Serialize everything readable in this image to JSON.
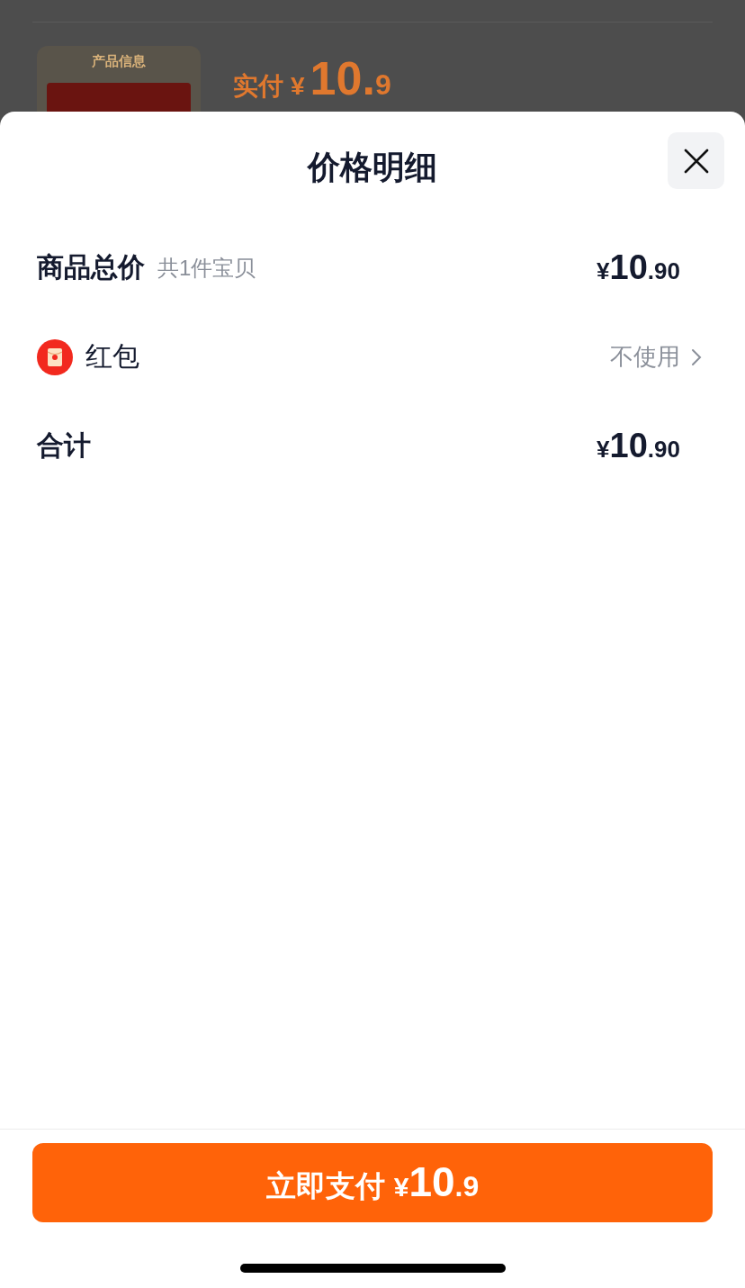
{
  "background_page": {
    "product_card": {
      "label": "产品信息"
    },
    "price_label": "实付",
    "price": {
      "symbol": "¥",
      "integer": "10.",
      "fraction": "9"
    }
  },
  "sheet": {
    "title": "价格明细",
    "rows": [
      {
        "kind": "subtotal",
        "label": "商品总价",
        "note": "共1件宝贝",
        "price": {
          "symbol": "¥",
          "integer": "10",
          "fraction": ".90"
        }
      },
      {
        "kind": "red_packet",
        "label": "红包",
        "value": "不使用"
      },
      {
        "kind": "total",
        "label": "合计",
        "price": {
          "symbol": "¥",
          "integer": "10",
          "fraction": ".90"
        }
      }
    ],
    "pay_button": {
      "label": "立即支付",
      "price": {
        "symbol": "¥",
        "integer": "10",
        "fraction": ".9"
      }
    }
  }
}
